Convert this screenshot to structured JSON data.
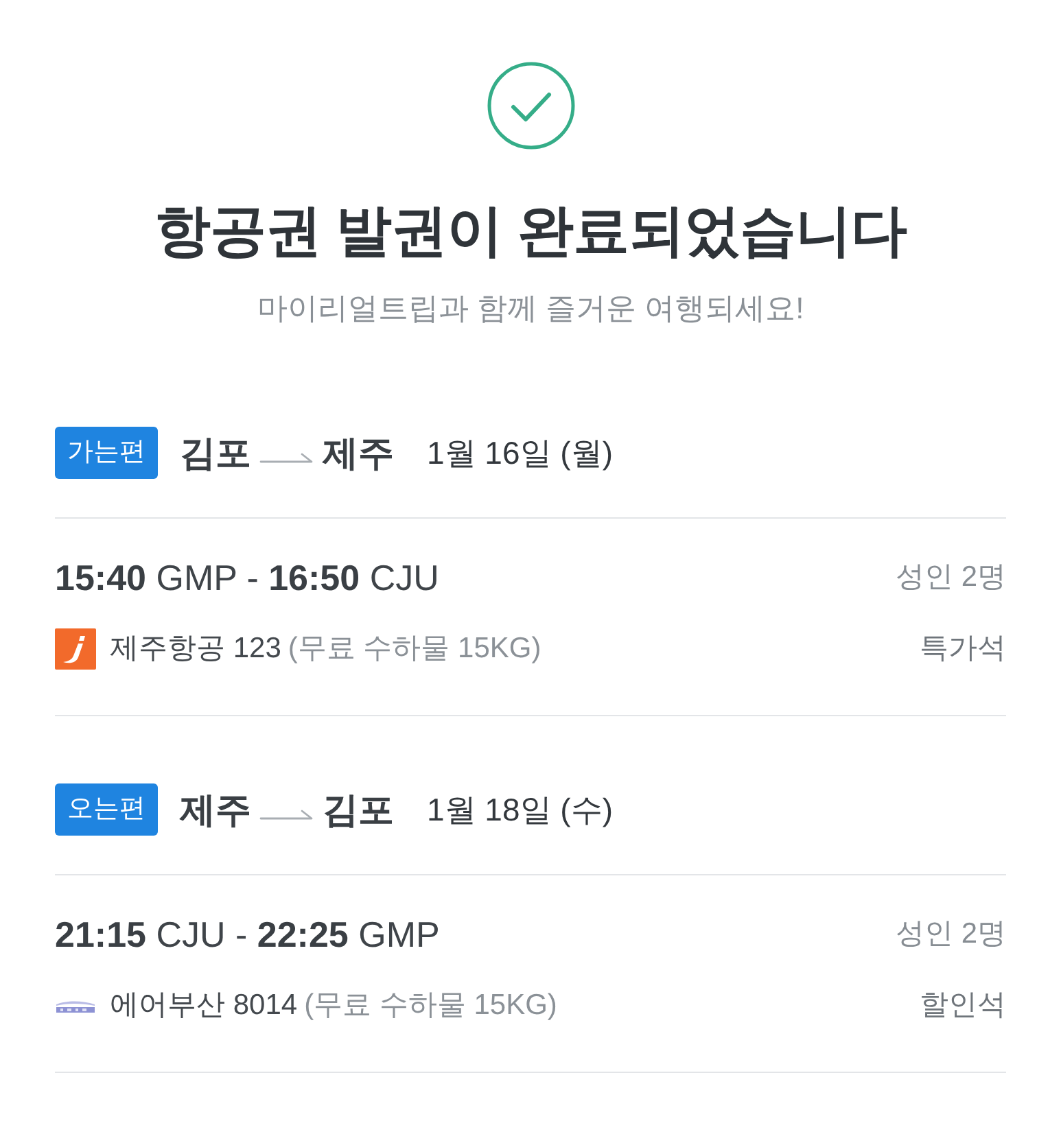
{
  "header": {
    "title": "항공권 발권이 완료되었습니다",
    "subtitle": "마이리얼트립과 함께 즐거운 여행되세요!"
  },
  "itineraries": [
    {
      "badge": "가는편",
      "origin": "김포",
      "destination": "제주",
      "date": "1월 16일 (월)",
      "flight": {
        "times": "**15:40** GMP - **16:50** CJU",
        "passengers": "성인 2명",
        "kind": "tile",
        "airline": "제주항공 123",
        "baggage": "(무료 수하물 15KG)",
        "seat_class": "특가석"
      }
    },
    {
      "badge": "오는편",
      "origin": "제주",
      "destination": "김포",
      "date": "1월 18일 (수)",
      "flight": {
        "times": "**21:15** CJU - **22:25** GMP",
        "passengers": "성인 2명",
        "kind": "wordmark",
        "airline": "에어부산 8014",
        "baggage": "(무료 수하물 15KG)",
        "seat_class": "할인석"
      }
    }
  ]
}
